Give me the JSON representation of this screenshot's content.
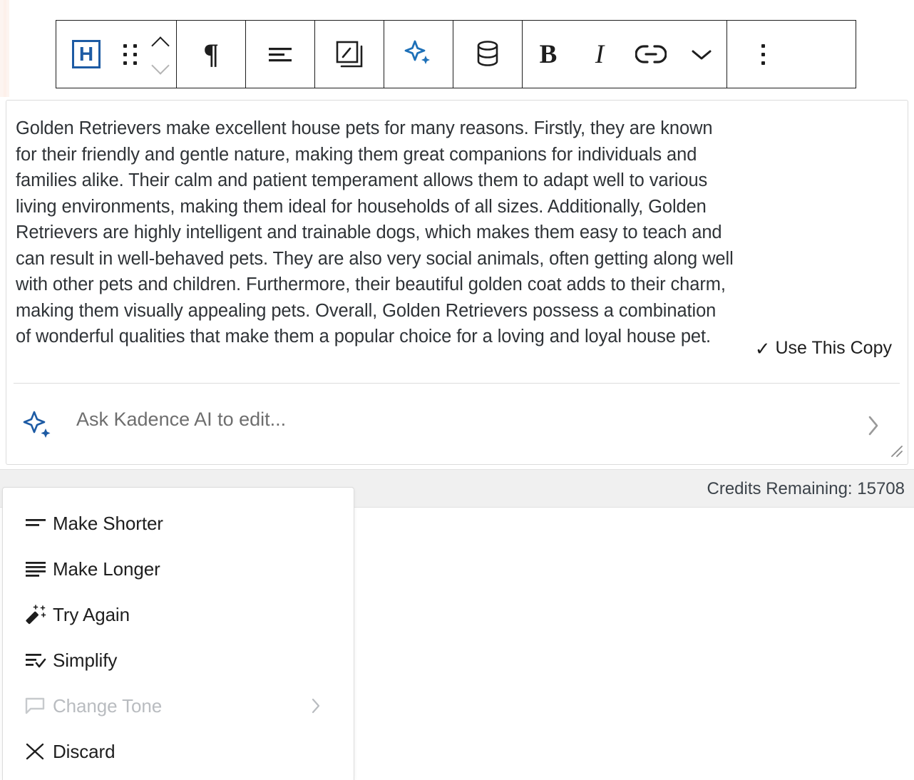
{
  "toolbar": {
    "block_type_label": "H",
    "block_type_name": "Heading block",
    "buttons": [
      {
        "name": "block-type-heading",
        "label": "H"
      },
      {
        "name": "drag-handle",
        "label": "Drag"
      },
      {
        "name": "move-up-down",
        "label": "Move up / Move down"
      },
      {
        "name": "paragraph-format",
        "label": "¶"
      },
      {
        "name": "align-text",
        "label": "Align text"
      },
      {
        "name": "design-library",
        "label": "Design Library"
      },
      {
        "name": "kadence-ai",
        "label": "Kadence AI"
      },
      {
        "name": "dynamic-data",
        "label": "Dynamic data"
      },
      {
        "name": "bold",
        "label": "B"
      },
      {
        "name": "italic",
        "label": "I"
      },
      {
        "name": "link",
        "label": "Link"
      },
      {
        "name": "more-rich-text",
        "label": "More"
      },
      {
        "name": "options",
        "label": "Options"
      }
    ]
  },
  "content": {
    "generated_text": "Golden Retrievers make excellent house pets for many reasons. Firstly, they are known for their friendly and gentle nature, making them great companions for individuals and families alike. Their calm and patient temperament allows them to adapt well to various living environments, making them ideal for households of all sizes. Additionally, Golden Retrievers are highly intelligent and trainable dogs, which makes them easy to teach and can result in well-behaved pets. They are also very social animals, often getting along well with other pets and children. Furthermore, their beautiful golden coat adds to their charm, making them visually appealing pets. Overall, Golden Retrievers possess a combination of wonderful qualities that make them a popular choice for a loving and loyal house pet.",
    "use_copy_label": "Use This Copy",
    "use_copy_check": "✓"
  },
  "prompt": {
    "placeholder": "Ask Kadence AI to edit...",
    "value": ""
  },
  "status": {
    "credits_label": "Credits Remaining: 15708"
  },
  "menu": {
    "items": [
      {
        "label": "Make Shorter",
        "icon": "lines-decreasing-icon",
        "disabled": false,
        "submenu": false
      },
      {
        "label": "Make Longer",
        "icon": "lines-increasing-icon",
        "disabled": false,
        "submenu": false
      },
      {
        "label": "Try Again",
        "icon": "magic-wand-icon",
        "disabled": false,
        "submenu": false
      },
      {
        "label": "Simplify",
        "icon": "lines-check-icon",
        "disabled": false,
        "submenu": false
      },
      {
        "label": "Change Tone",
        "icon": "speech-bubble-icon",
        "disabled": true,
        "submenu": true
      },
      {
        "label": "Discard",
        "icon": "close-x-icon",
        "disabled": false,
        "submenu": false
      }
    ]
  },
  "colors": {
    "accent_blue": "#1d70b8",
    "block_icon_blue": "#1d5ba4",
    "panel_border": "#dcdcdc",
    "credits_bg": "#f0f0f0",
    "peach_strip": "#fdf4f0",
    "text_primary": "#1e1e1e",
    "text_body": "#2f3337",
    "disabled_grey": "#b9bcc0"
  }
}
